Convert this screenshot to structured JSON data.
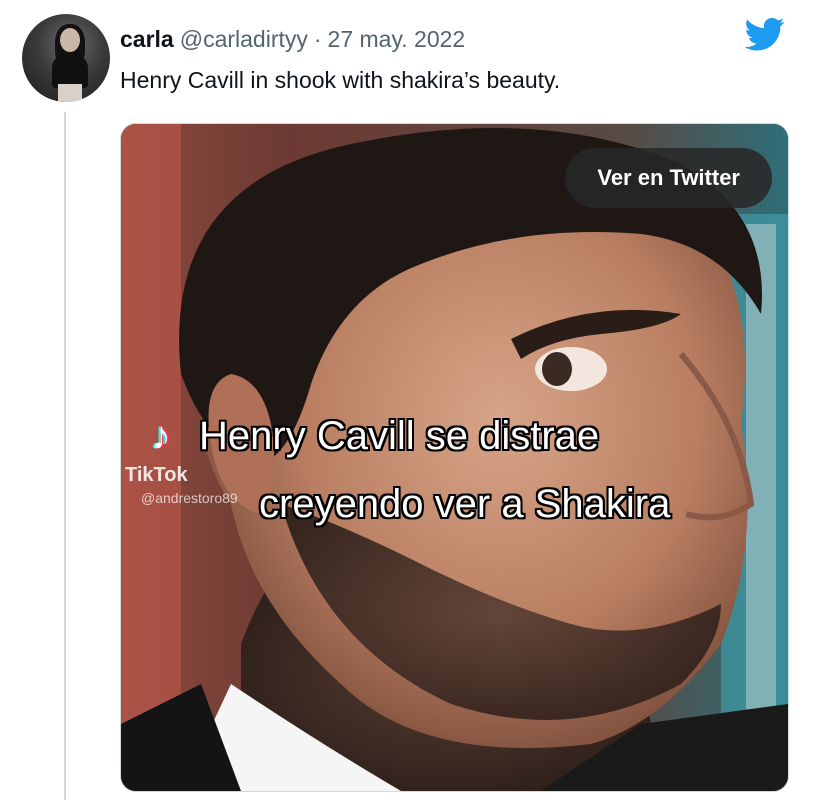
{
  "tweet": {
    "display_name": "carla",
    "handle": "@carladirtyy",
    "separator": "·",
    "date": "27 may. 2022",
    "text": "Henry Cavill in shook with shakira’s beauty."
  },
  "media": {
    "view_button_label": "Ver en Twitter",
    "caption_line1": "Henry Cavill se distrae",
    "caption_line2": "creyendo ver a Shakira",
    "watermark_brand": "TikTok",
    "watermark_user": "@andrestoro89"
  },
  "icons": {
    "brand": "twitter-bird-icon",
    "watermark": "tiktok-note-icon"
  },
  "colors": {
    "twitter_blue": "#1d9bf0",
    "text_primary": "#0f1419",
    "text_secondary": "#536471",
    "thread_line": "#cfd9de"
  }
}
